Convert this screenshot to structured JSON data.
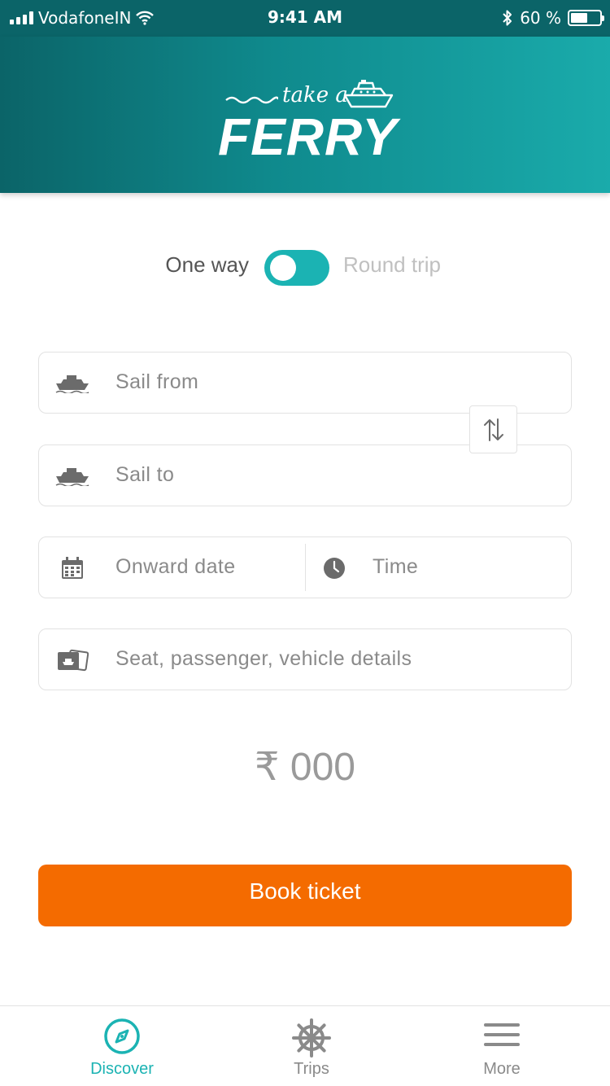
{
  "status_bar": {
    "carrier": "VodafoneIN",
    "time": "9:41 AM",
    "battery": "60 %",
    "battery_level": 0.6
  },
  "header": {
    "logo_small": "take a",
    "logo_big": "FERRY"
  },
  "trip_type": {
    "one_way_label": "One way",
    "round_trip_label": "Round trip",
    "selected": "One way"
  },
  "form": {
    "sail_from_placeholder": "Sail from",
    "sail_to_placeholder": "Sail to",
    "onward_date_placeholder": "Onward date",
    "time_placeholder": "Time",
    "details_placeholder": "Seat, passenger, vehicle details"
  },
  "price": "₹ 000",
  "book_label": "Book ticket",
  "tabs": [
    {
      "label": "Discover",
      "icon": "compass-icon",
      "active": true
    },
    {
      "label": "Trips",
      "icon": "ship-wheel-icon",
      "active": false
    },
    {
      "label": "More",
      "icon": "menu-icon",
      "active": false
    }
  ],
  "colors": {
    "header_dark": "#0b6468",
    "header_light": "#1aabab",
    "accent": "#1bb3b3",
    "book_button": "#f46b00"
  }
}
